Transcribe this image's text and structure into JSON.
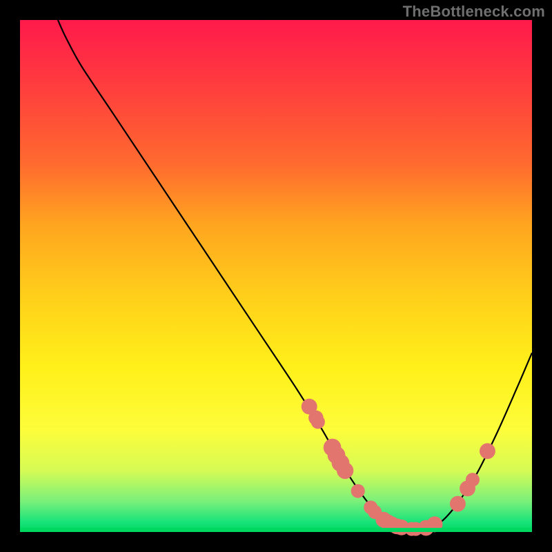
{
  "watermark": "TheBottleneck.com",
  "colors": {
    "marker": "#e2766f",
    "curve": "#000000"
  },
  "chart_data": {
    "type": "line",
    "title": "",
    "xlabel": "",
    "ylabel": "",
    "xlim": [
      0,
      100
    ],
    "ylim": [
      0,
      100
    ],
    "grid": false,
    "legend": false,
    "curve": [
      {
        "x": 7.4,
        "y": 100
      },
      {
        "x": 9.0,
        "y": 96.5
      },
      {
        "x": 12.0,
        "y": 91.0
      },
      {
        "x": 18.0,
        "y": 82.0
      },
      {
        "x": 26.0,
        "y": 70.0
      },
      {
        "x": 36.0,
        "y": 55.0
      },
      {
        "x": 46.0,
        "y": 40.0
      },
      {
        "x": 54.0,
        "y": 28.0
      },
      {
        "x": 59.0,
        "y": 20.0
      },
      {
        "x": 63.0,
        "y": 13.0
      },
      {
        "x": 67.0,
        "y": 7.0
      },
      {
        "x": 70.0,
        "y": 3.5
      },
      {
        "x": 73.0,
        "y": 1.5
      },
      {
        "x": 76.0,
        "y": 0.6
      },
      {
        "x": 79.0,
        "y": 0.6
      },
      {
        "x": 82.0,
        "y": 1.8
      },
      {
        "x": 85.0,
        "y": 5.0
      },
      {
        "x": 89.0,
        "y": 11.0
      },
      {
        "x": 93.0,
        "y": 19.0
      },
      {
        "x": 97.0,
        "y": 28.0
      },
      {
        "x": 100.0,
        "y": 35.0
      }
    ],
    "markers": [
      {
        "x": 56.5,
        "y": 24.5,
        "r": 1.2
      },
      {
        "x": 57.8,
        "y": 22.3,
        "r": 1.1
      },
      {
        "x": 58.2,
        "y": 21.5,
        "r": 1.0
      },
      {
        "x": 61.0,
        "y": 16.5,
        "r": 1.4
      },
      {
        "x": 61.8,
        "y": 15.0,
        "r": 1.4
      },
      {
        "x": 62.6,
        "y": 13.5,
        "r": 1.4
      },
      {
        "x": 63.5,
        "y": 12.0,
        "r": 1.3
      },
      {
        "x": 66.0,
        "y": 8.0,
        "r": 1.0
      },
      {
        "x": 68.5,
        "y": 4.8,
        "r": 1.0
      },
      {
        "x": 69.3,
        "y": 3.9,
        "r": 1.0
      },
      {
        "x": 71.0,
        "y": 2.4,
        "r": 1.2
      },
      {
        "x": 71.8,
        "y": 1.9,
        "r": 1.2
      },
      {
        "x": 72.6,
        "y": 1.5,
        "r": 1.2
      },
      {
        "x": 73.6,
        "y": 1.1,
        "r": 1.2
      },
      {
        "x": 74.5,
        "y": 0.9,
        "r": 1.2
      },
      {
        "x": 76.5,
        "y": 0.6,
        "r": 1.0
      },
      {
        "x": 77.3,
        "y": 0.6,
        "r": 1.0
      },
      {
        "x": 79.3,
        "y": 0.8,
        "r": 1.2
      },
      {
        "x": 81.0,
        "y": 1.5,
        "r": 1.2
      },
      {
        "x": 85.5,
        "y": 5.5,
        "r": 1.2
      },
      {
        "x": 87.4,
        "y": 8.5,
        "r": 1.2
      },
      {
        "x": 88.4,
        "y": 10.2,
        "r": 1.0
      },
      {
        "x": 91.3,
        "y": 15.8,
        "r": 1.2
      }
    ]
  }
}
